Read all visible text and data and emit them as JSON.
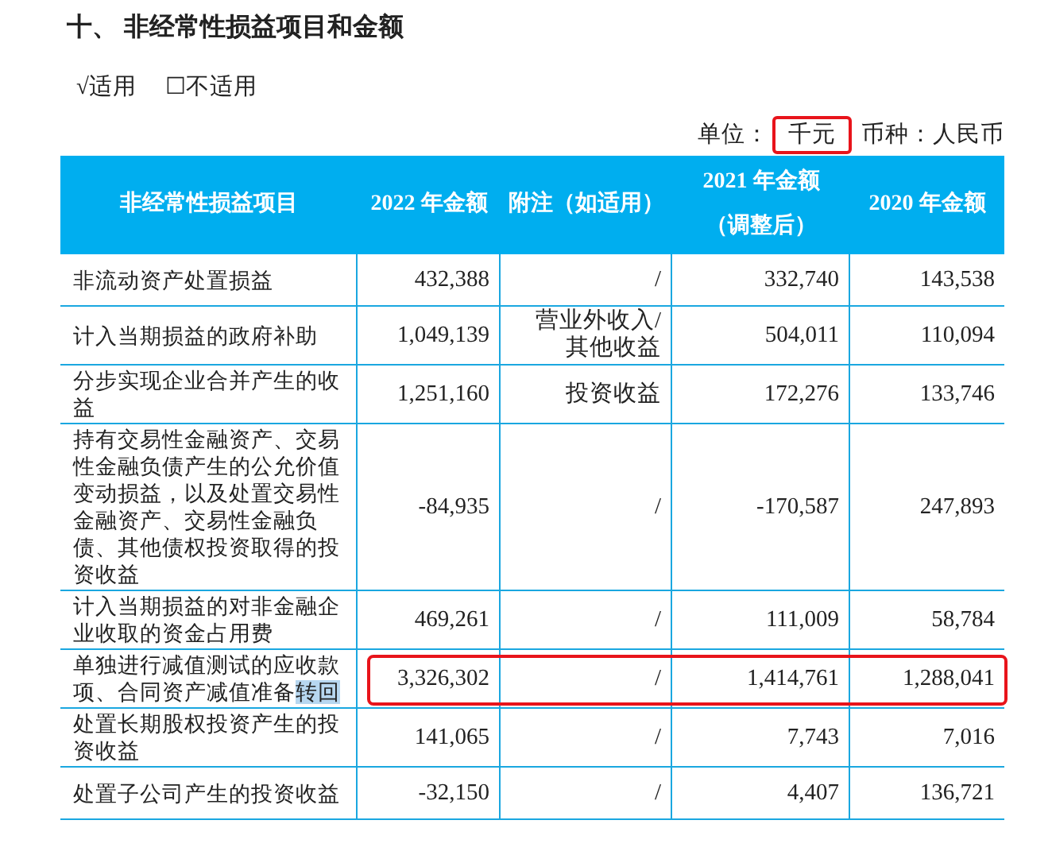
{
  "section_title": "十、 非经常性损益项目和金额",
  "options": [
    {
      "label": "√适用"
    },
    {
      "label": "☐不适用"
    }
  ],
  "unit": {
    "label": "单位：",
    "value": "千元",
    "annotated": true
  },
  "currency": {
    "label": "币种：",
    "value": "人民币"
  },
  "table": {
    "columns": [
      [
        "非经常性损益项目"
      ],
      [
        "2022 年金额"
      ],
      [
        "附注（如适用）"
      ],
      [
        "2021 年金额",
        "（调整后）"
      ],
      [
        "2020 年金额"
      ]
    ],
    "rows": [
      {
        "item": "非流动资产处置损益",
        "v2022": "432,388",
        "note": "/",
        "v2021": "332,740",
        "v2020": "143,538",
        "annotated": false
      },
      {
        "item": "计入当期损益的政府补助",
        "v2022": "1,049,139",
        "note": "营业外收入/\n其他收益",
        "v2021": "504,011",
        "v2020": "110,094",
        "annotated": false
      },
      {
        "item": "分步实现企业合并产生的收益",
        "v2022": "1,251,160",
        "note": "投资收益",
        "v2021": "172,276",
        "v2020": "133,746",
        "annotated": false
      },
      {
        "item": "持有交易性金融资产、交易性金融负债产生的公允价值变动损益，以及处置交易性金融资产、交易性金融负债、其他债权投资取得的投资收益",
        "v2022": "-84,935",
        "note": "/",
        "v2021": "-170,587",
        "v2020": "247,893",
        "annotated": false
      },
      {
        "item": "计入当期损益的对非金融企业收取的资金占用费",
        "v2022": "469,261",
        "note": "/",
        "v2021": "111,009",
        "v2020": "58,784",
        "annotated": false
      },
      {
        "item": "单独进行减值测试的应收款项、合同资产减值准备",
        "item_highlighted": "转回",
        "v2022": "3,326,302",
        "note": "/",
        "v2021": "1,414,761",
        "v2020": "1,288,041",
        "annotated": true
      },
      {
        "item": "处置长期股权投资产生的投资收益",
        "v2022": "141,065",
        "note": "/",
        "v2021": "7,743",
        "v2020": "7,016",
        "annotated": false
      },
      {
        "item": "处置子公司产生的投资收益",
        "v2022": "-32,150",
        "note": "/",
        "v2021": "4,407",
        "v2020": "136,721",
        "annotated": false
      }
    ]
  }
}
